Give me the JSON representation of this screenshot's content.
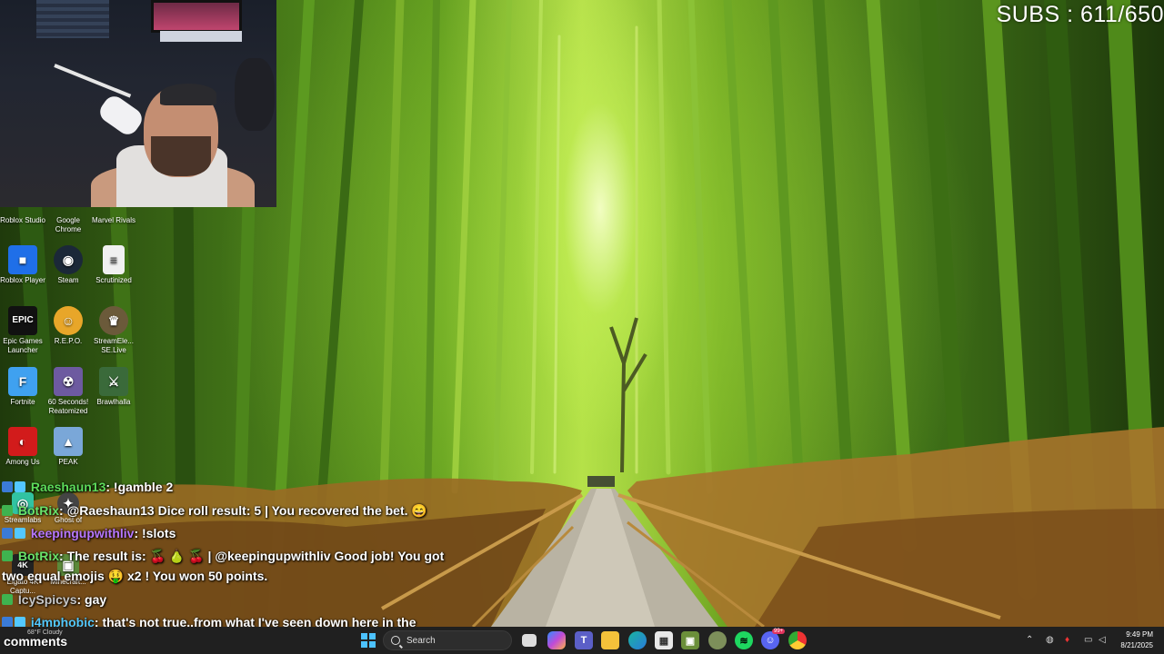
{
  "overlay": {
    "subs_label": "SUBS : 611/650",
    "comments_label": "comments"
  },
  "desktop": {
    "icons": [
      {
        "label": "Roblox Studio",
        "icon": "roblox-studio-icon"
      },
      {
        "label": "Google Chrome",
        "icon": "chrome-icon"
      },
      {
        "label": "Marvel Rivals",
        "icon": "marvel-rivals-icon"
      },
      {
        "label": "Roblox Player",
        "icon": "roblox-player-icon"
      },
      {
        "label": "Steam",
        "icon": "steam-icon"
      },
      {
        "label": "Scrutinized",
        "icon": "file-icon"
      },
      {
        "label": "Epic Games Launcher",
        "icon": "epic-games-icon"
      },
      {
        "label": "R.E.P.O.",
        "icon": "repo-icon"
      },
      {
        "label": "StreamEle... SE.Live",
        "icon": "streamelements-icon"
      },
      {
        "label": "Fortnite",
        "icon": "fortnite-icon"
      },
      {
        "label": "60 Seconds! Reatomized",
        "icon": "sixty-seconds-icon"
      },
      {
        "label": "Brawlhalla",
        "icon": "brawlhalla-icon"
      },
      {
        "label": "Among Us",
        "icon": "among-us-icon"
      },
      {
        "label": "PEAK",
        "icon": "peak-icon"
      },
      {
        "label": "Streamlabs",
        "icon": "streamlabs-icon"
      },
      {
        "label": "Ghost of",
        "icon": "ghost-icon"
      },
      {
        "label": "Elgato 4K Captu...",
        "icon": "elgato-icon"
      },
      {
        "label": "Minecraft...",
        "icon": "minecraft-icon"
      }
    ]
  },
  "chat": {
    "messages": [
      {
        "user": "Raeshaun13",
        "text": ": !gamble 2"
      },
      {
        "user": "BotRix",
        "text": ": @Raeshaun13 Dice roll result: 5 | You recovered the bet. 😄"
      },
      {
        "user": "keepingupwithliv",
        "text": ": !slots"
      },
      {
        "user": "BotRix",
        "text": ": The result is: 🍒 🍐 🍒 | @keepingupwithliv Good job! You got"
      },
      {
        "user": "",
        "text": "two equal emojis 🤑 x2 ! You won 50 points."
      },
      {
        "user": "IcySpicys",
        "text": ": gay"
      },
      {
        "user": "j4mphobic",
        "text": ": that's not true..from what I've seen down here in the"
      }
    ]
  },
  "taskbar": {
    "search_placeholder": "Search",
    "weather_temp": "68°F",
    "weather_desc": "Cloudy",
    "time": "9:49 PM",
    "date": "8/21/2025",
    "discord_badge": "99+",
    "pinned": [
      {
        "name": "start-icon"
      },
      {
        "name": "task-view-icon"
      },
      {
        "name": "copilot-icon"
      },
      {
        "name": "teams-icon"
      },
      {
        "name": "file-explorer-icon"
      },
      {
        "name": "edge-icon"
      },
      {
        "name": "store-icon"
      },
      {
        "name": "minecraft-icon"
      },
      {
        "name": "app-icon"
      },
      {
        "name": "spotify-icon"
      },
      {
        "name": "discord-icon"
      },
      {
        "name": "chrome-icon"
      }
    ]
  },
  "colors": {
    "taskbar_bg": "#202020",
    "chat_user_green": "#5ddc5a",
    "chat_user_purple": "#b777ff",
    "chat_user_blue": "#53c8ff"
  }
}
